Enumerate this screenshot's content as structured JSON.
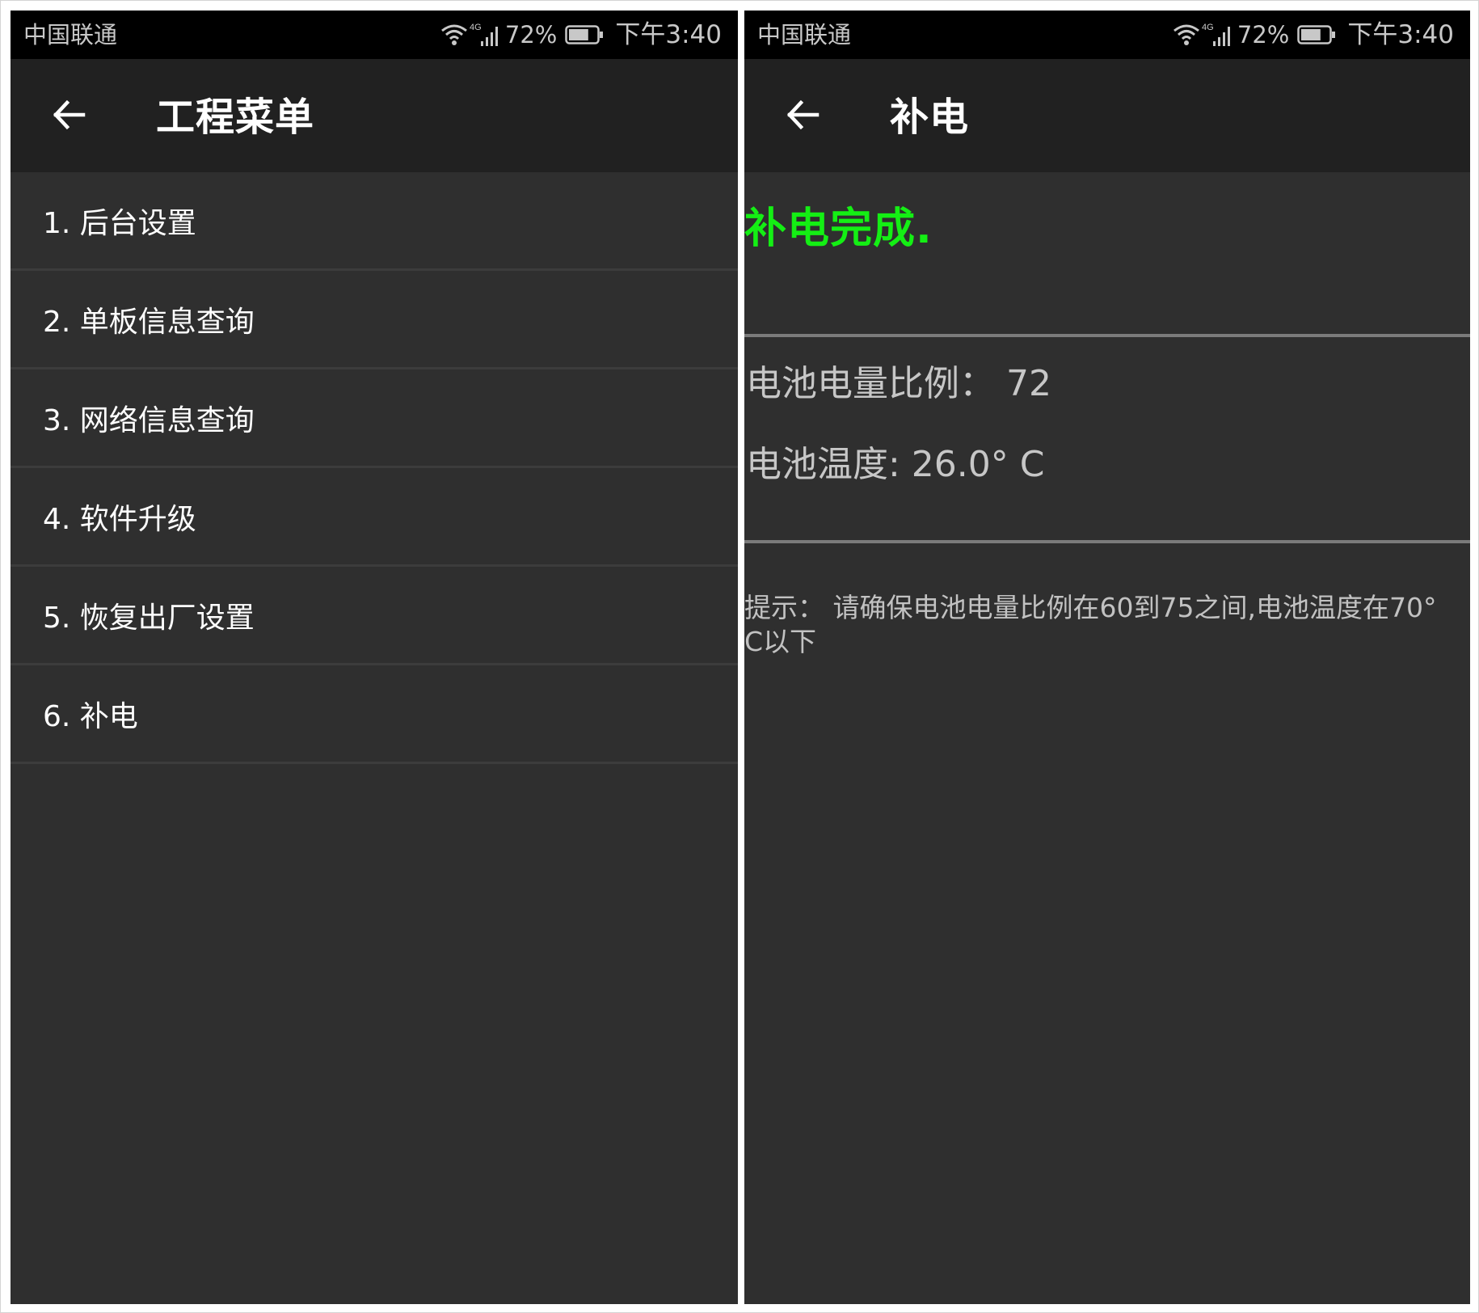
{
  "status_bar": {
    "carrier": "中国联通",
    "network_badge": "4G",
    "battery_pct": "72%",
    "battery_level": 0.72,
    "time": "下午3:40",
    "icons": [
      "wifi-icon",
      "signal-icon",
      "battery-icon"
    ]
  },
  "left_screen": {
    "title": "工程菜单",
    "menu": [
      {
        "label": "1. 后台设置"
      },
      {
        "label": "2. 单板信息查询"
      },
      {
        "label": "3. 网络信息查询"
      },
      {
        "label": "4. 软件升级"
      },
      {
        "label": "5. 恢复出厂设置"
      },
      {
        "label": "6. 补电"
      }
    ]
  },
  "right_screen": {
    "title": "补电",
    "status_text": "补电完成.",
    "battery_ratio_line": "电池电量比例：  72",
    "battery_temp_line": "电池温度: 26.0° C",
    "hint": "提示：  请确保电池电量比例在60到75之间,电池温度在70° C以下"
  },
  "colors": {
    "background": "#2f2f2f",
    "appbar": "#212121",
    "statusbar": "#000000",
    "success_text": "#14ef14",
    "divider": "#7b7b7b"
  }
}
